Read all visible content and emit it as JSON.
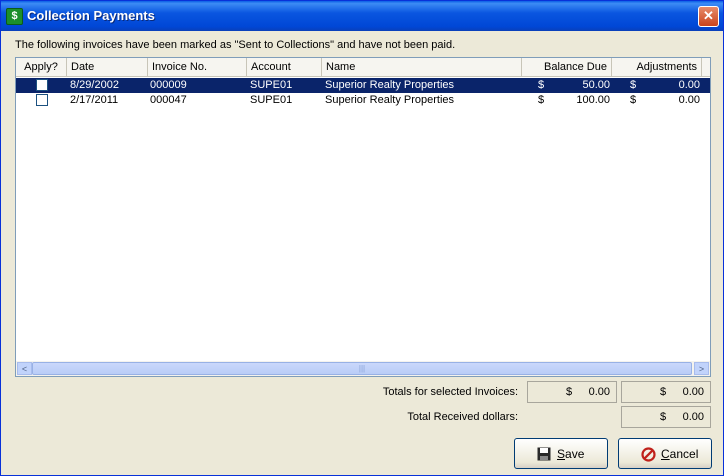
{
  "window": {
    "title": "Collection Payments",
    "close_glyph": "✕",
    "icon_glyph": "$"
  },
  "notice": "The following invoices have been marked as \"Sent to Collections\" and have not been paid.",
  "columns": [
    "Apply?",
    "Date",
    "Invoice No.",
    "Account",
    "Name",
    "Balance Due",
    "Adjustments"
  ],
  "rows": [
    {
      "date": "8/29/2002",
      "invoice": "000009",
      "account": "SUPE01",
      "name": "Superior Realty Properties",
      "balance_symbol": "$",
      "balance": "50.00",
      "adj_symbol": "$",
      "adjustment": "0.00",
      "checked": false,
      "selected": true
    },
    {
      "date": "2/17/2011",
      "invoice": "000047",
      "account": "SUPE01",
      "name": "Superior Realty Properties",
      "balance_symbol": "$",
      "balance": "100.00",
      "adj_symbol": "$",
      "adjustment": "0.00",
      "checked": false,
      "selected": false
    }
  ],
  "scroll": {
    "left": "<",
    "right": ">",
    "grip": "|||"
  },
  "totals": {
    "selected_label": "Totals for selected Invoices:",
    "selected_balance_symbol": "$",
    "selected_balance": "0.00",
    "selected_adj_symbol": "$",
    "selected_adjustment": "0.00",
    "received_label": "Total Received dollars:",
    "received_symbol": "$",
    "received": "0.00"
  },
  "buttons": {
    "save": "Save",
    "cancel": "Cancel"
  },
  "colors": {
    "title_blue": "#0a56e0",
    "selection": "#0a246a",
    "face": "#ece9d8"
  },
  "icons": {
    "app": "dollar-icon",
    "save": "floppy-disk-icon",
    "cancel": "no-entry-icon"
  }
}
